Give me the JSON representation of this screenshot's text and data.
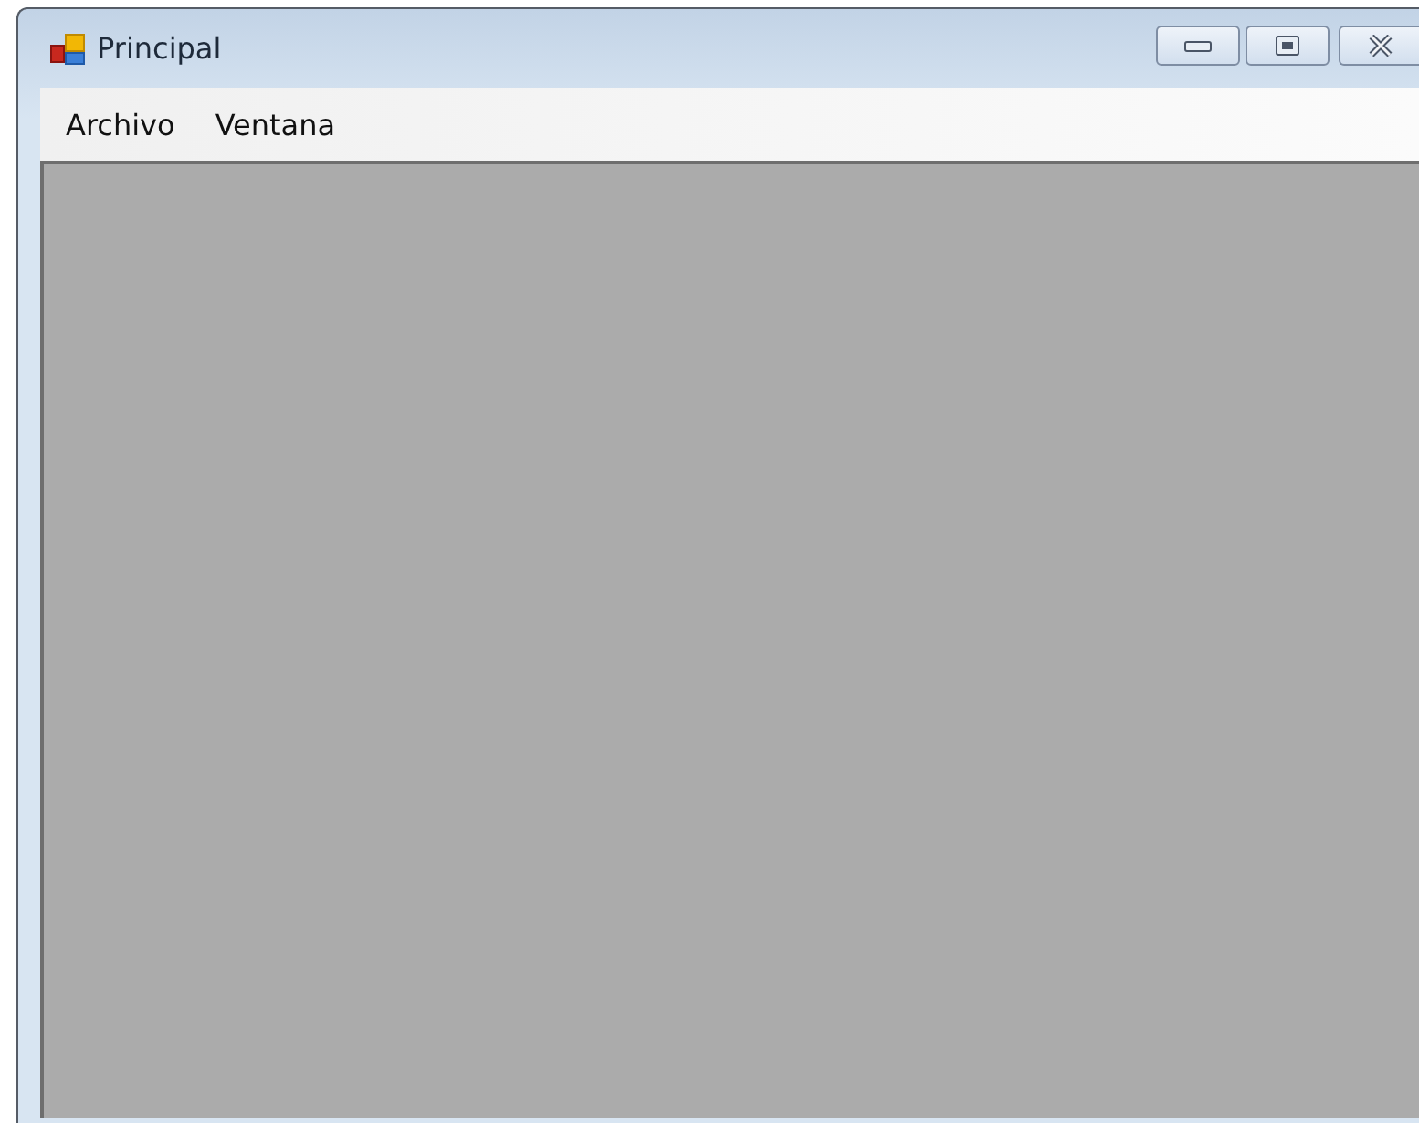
{
  "window": {
    "title": "Principal"
  },
  "menu": [
    {
      "label": "Archivo"
    },
    {
      "label": "Ventana"
    }
  ]
}
